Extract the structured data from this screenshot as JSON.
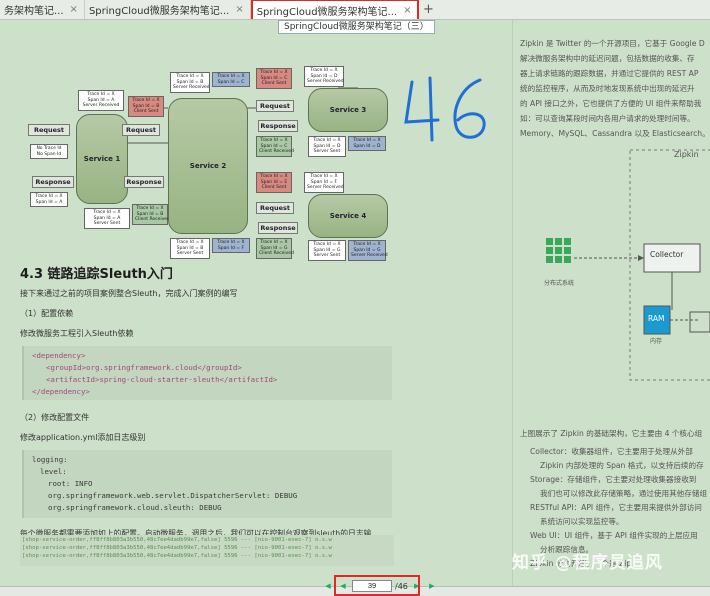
{
  "tabs": [
    {
      "label": "务架构笔记...",
      "close": "×",
      "active": false
    },
    {
      "label": "SpringCloud微服务架构笔记...",
      "close": "×",
      "active": false
    },
    {
      "label": "SpringCloud微服务架构笔记...",
      "close": "×",
      "active": true
    }
  ],
  "new_tab": "+",
  "tooltip": "SpringCloud微服务架构笔记（三）",
  "diagram": {
    "service1": "Service 1",
    "service2": "Service 2",
    "service3": "Service 3",
    "service4": "Service 4",
    "request": "Request",
    "response": "Response",
    "no_ids": "No Trace Id\nNo Span Id",
    "trace_a": "Trace Id = X\nSpan Id = A",
    "trace_a_sr": "Trace Id = X\nSpan Id = A\nServer Received",
    "trace_a_ss": "Trace Id = X\nSpan Id = A\nServer Sent",
    "trace_b_cs": "Trace Id = X\nSpan Id = B\nClient Sent",
    "trace_b_sr": "Trace Id = X\nSpan Id = B\nServer Received",
    "trace_b_ss": "Trace Id = X\nSpan Id = B\nServer Sent",
    "trace_b_cr": "Trace Id = X\nSpan Id = B\nClient Received",
    "trace_c": "Trace Id = X\nSpan Id = C",
    "trace_c_cs": "Trace Id = X\nSpan Id = C\nClient Sent",
    "trace_d": "Trace Id = X\nSpan Id = D",
    "trace_d_sr": "Trace Id = X\nSpan Id = D\nServer Received",
    "trace_d_ss": "Trace Id = X\nSpan Id = D\nServer Sent",
    "trace_d_cr": "Trace Id = X\nSpan Id = D\nClient Received",
    "trace_e_cs": "Trace Id = X\nSpan Id = E\nClient Sent",
    "trace_e_cr": "Trace Id = X\nSpan Id = E\nClient Received",
    "trace_f_sr": "Trace Id = X\nSpan Id = F\nServer Received",
    "trace_f": "Trace Id = X\nSpan Id = F",
    "trace_f_ss": "Trace Id = X\nSpan Id = F\nServer Sent",
    "trace_g_cs": "Trace Id = X\nSpan Id = G\nClient Sent",
    "trace_g_cr": "Trace Id = X\nSpan Id = G\nClient Received",
    "trace_g_ss": "Trace Id = X\nSpan Id = G\nServer Sent",
    "trace_g_sr": "Trace Id = X\nSpan Id = G\nServer Received",
    "trace_c_cr": "Trace Id = X\nSpan Id = C\nClient Received"
  },
  "handwritten_note": "46",
  "left": {
    "heading": "4.3 链路追踪Sleuth入门",
    "intro": "接下来通过之前的项目案例整合Sleuth，完成入门案例的编写",
    "step1": "（1）配置依赖",
    "step1_desc": "修改微服务工程引入Sleuth依赖",
    "code1": [
      {
        "text": "<dependency>",
        "indent": 0
      },
      {
        "text": "<groupId>org.springframework.cloud</groupId>",
        "indent": 1
      },
      {
        "text": "<artifactId>spring-cloud-starter-sleuth</artifactId>",
        "indent": 1
      },
      {
        "text": "</dependency>",
        "indent": 0
      }
    ],
    "step2": "（2）修改配置文件",
    "step2_desc": "修改application.yml添加日志级别",
    "code2": [
      {
        "text": "logging:",
        "indent": 0
      },
      {
        "text": "level:",
        "indent": 1
      },
      {
        "text": "root: INFO",
        "indent": 2
      },
      {
        "text": "org.springframework.web.servlet.DispatcherServlet: DEBUG",
        "indent": 2
      },
      {
        "text": "org.springframework.cloud.sleuth: DEBUG",
        "indent": 2
      }
    ],
    "after_code": "每个微服务都需要添加如上的配置。启动微服务，调用之后，我们可以在控制台观察到sleuth的日志输",
    "after_code2": "出。",
    "log_lines": [
      "[shop-service-order,ff8ff8b803a3b550,48c7ee4dadb99e7,false] 5596 --- [nio-9001-exec-7] o.s.w",
      "[shop-service-order,ff8ff8b803a3b550,48c7ee4dadb99e7,false] 5596 --- [nio-9001-exec-7] o.s.w",
      "[shop-service-order,ff8ff8b803a3b550,48c7ee4dadb99e7,false] 5596 --- [nio-9001-exec-7] o.s.w"
    ]
  },
  "right": {
    "lines": [
      "Zipkin 是 Twitter 的一个开源项目，它基于 Google D",
      "解决微服务架构中的延迟问题，包括数据的收集、存",
      "器上请求链路的跟踪数据，并通过它提供的 REST AP",
      "统的监控程序，从而及时地发现系统中出现的延迟升",
      "的 API 接口之外，它也提供了方便的 UI 组件来帮助我",
      "如：可以查询某段时间内各用户请求的处理时间等。",
      "Memory、MySQL、Cassandra 以及 Elasticsearch。"
    ],
    "arch_title": "Zipkin",
    "collector": "Collector",
    "ram": "RAM",
    "mem_label": "内存",
    "dist_label": "分布式系统",
    "after_diagram": "上图展示了 Zipkin 的基础架构，它主要由 4 个核心组",
    "bullets": [
      "Collector：收集器组件，它主要用于处理从外部",
      "Zipkin 内部处理的 Span 格式，以支持后续的存",
      "Storage：存储组件，它主要对处理收集器接收到",
      "我们也可以修改此存储策略，通过使用其他存储组",
      "RESTful API：API 组件，它主要用来提供外部访问",
      "系统访问以实现监控等。",
      "Web UI：UI 组件，基于 API 组件实现的上层应用",
      "分析跟踪信息。",
      "Zipkin 分为两端，一个是 Zip"
    ],
    "watermark": "知乎 @程序员追风"
  },
  "nav": {
    "first": "◀",
    "prev": "◀",
    "current_page": "39",
    "total": "/46",
    "next": "▶",
    "last": "▶"
  }
}
